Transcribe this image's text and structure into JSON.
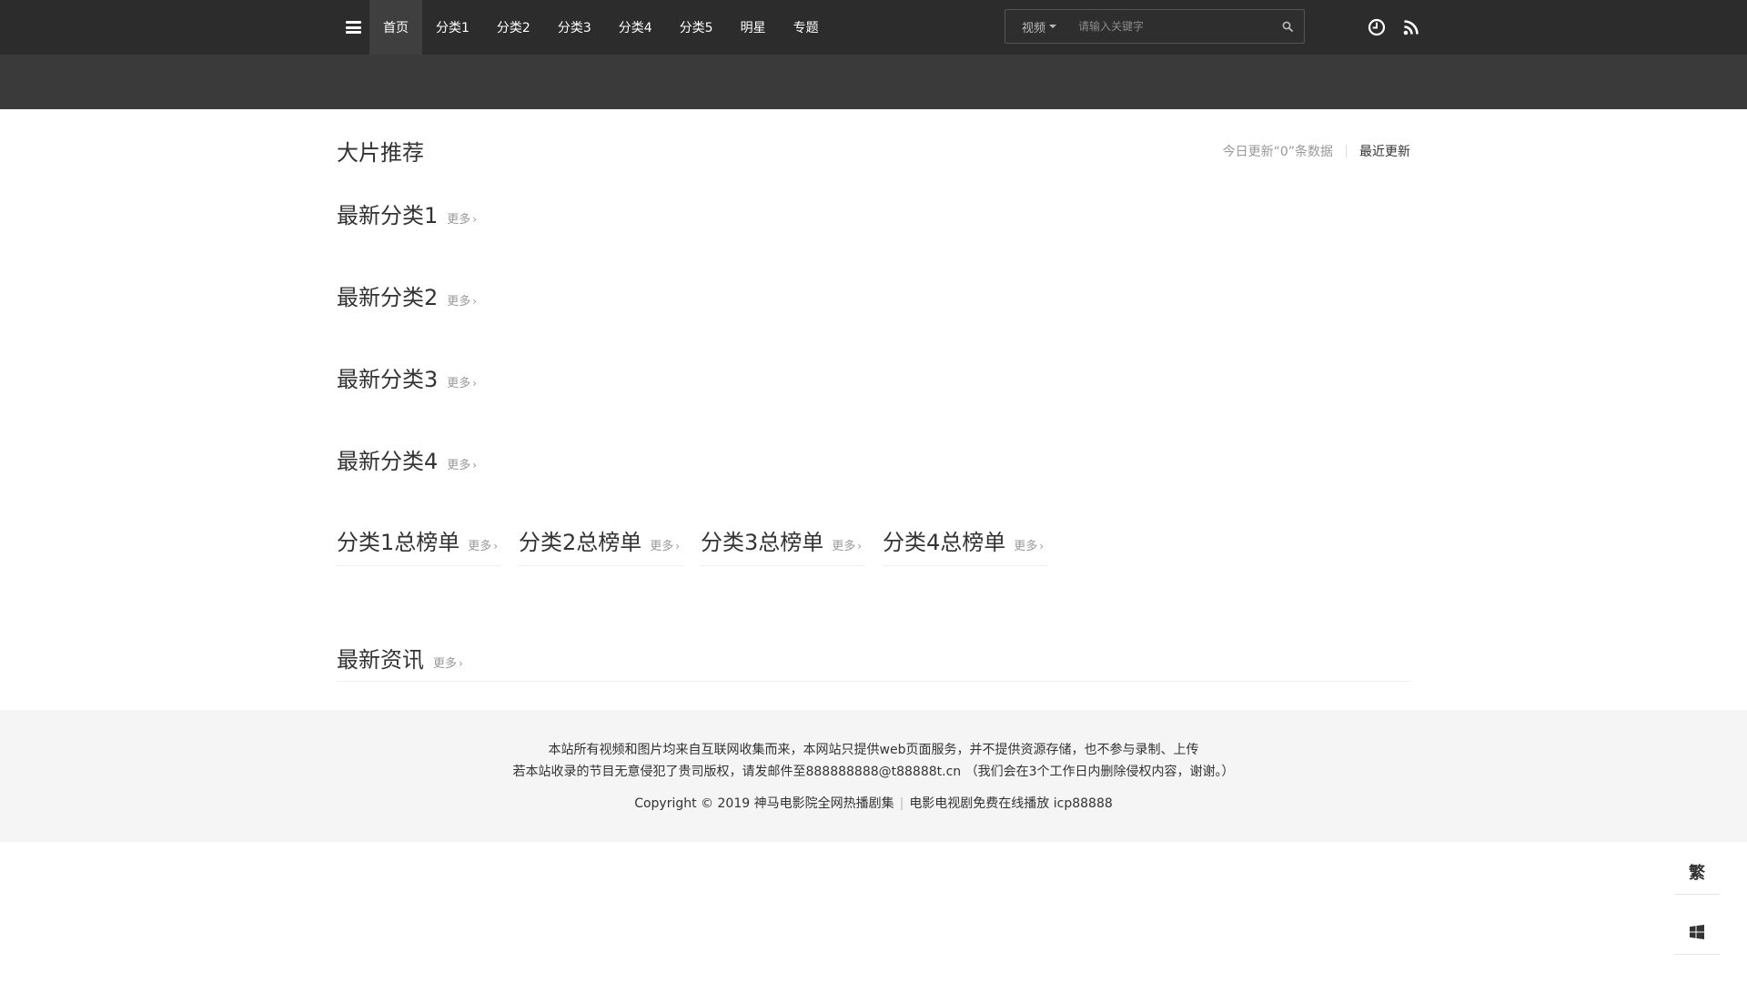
{
  "header": {
    "nav": [
      "首页",
      "分类1",
      "分类2",
      "分类3",
      "分类4",
      "分类5",
      "明星",
      "专题"
    ],
    "search": {
      "type_label": "视频",
      "placeholder": "请输入关键字"
    },
    "icons": [
      "menu-icon",
      "search-icon",
      "history-clock-icon",
      "rss-icon"
    ]
  },
  "hot": {
    "title": "大片推荐",
    "today_update": "今日更新“0”条数据",
    "recent_link": "最近更新"
  },
  "sections": [
    {
      "title": "最新分类1",
      "more": "更多"
    },
    {
      "title": "最新分类2",
      "more": "更多"
    },
    {
      "title": "最新分类3",
      "more": "更多"
    },
    {
      "title": "最新分类4",
      "more": "更多"
    }
  ],
  "rankings": [
    {
      "title": "分类1总榜单",
      "more": "更多"
    },
    {
      "title": "分类2总榜单",
      "more": "更多"
    },
    {
      "title": "分类3总榜单",
      "more": "更多"
    },
    {
      "title": "分类4总榜单",
      "more": "更多"
    }
  ],
  "news": {
    "title": "最新资讯",
    "more": "更多"
  },
  "footer": {
    "line1": "本站所有视频和图片均来自互联网收集而来，本网站只提供web页面服务，并不提供资源存储，也不参与录制、上传",
    "line2": "若本站收录的节目无意侵犯了贵司版权，请发邮件至888888888@t88888t.cn （我们会在3个工作日内删除侵权内容，谢谢。）",
    "copyright": "Copyright © 2019 神马电影院全网热播剧集",
    "tagline": "电影电视剧免费在线播放 icp88888"
  },
  "side_tools": {
    "traditional_label": "繁",
    "icons": [
      "windows-icon"
    ]
  },
  "colors": {
    "topbar": "#2c2c2c",
    "subbar": "#3a3a3a",
    "footer_bg": "#f5f5f5",
    "muted_text": "#999999"
  }
}
